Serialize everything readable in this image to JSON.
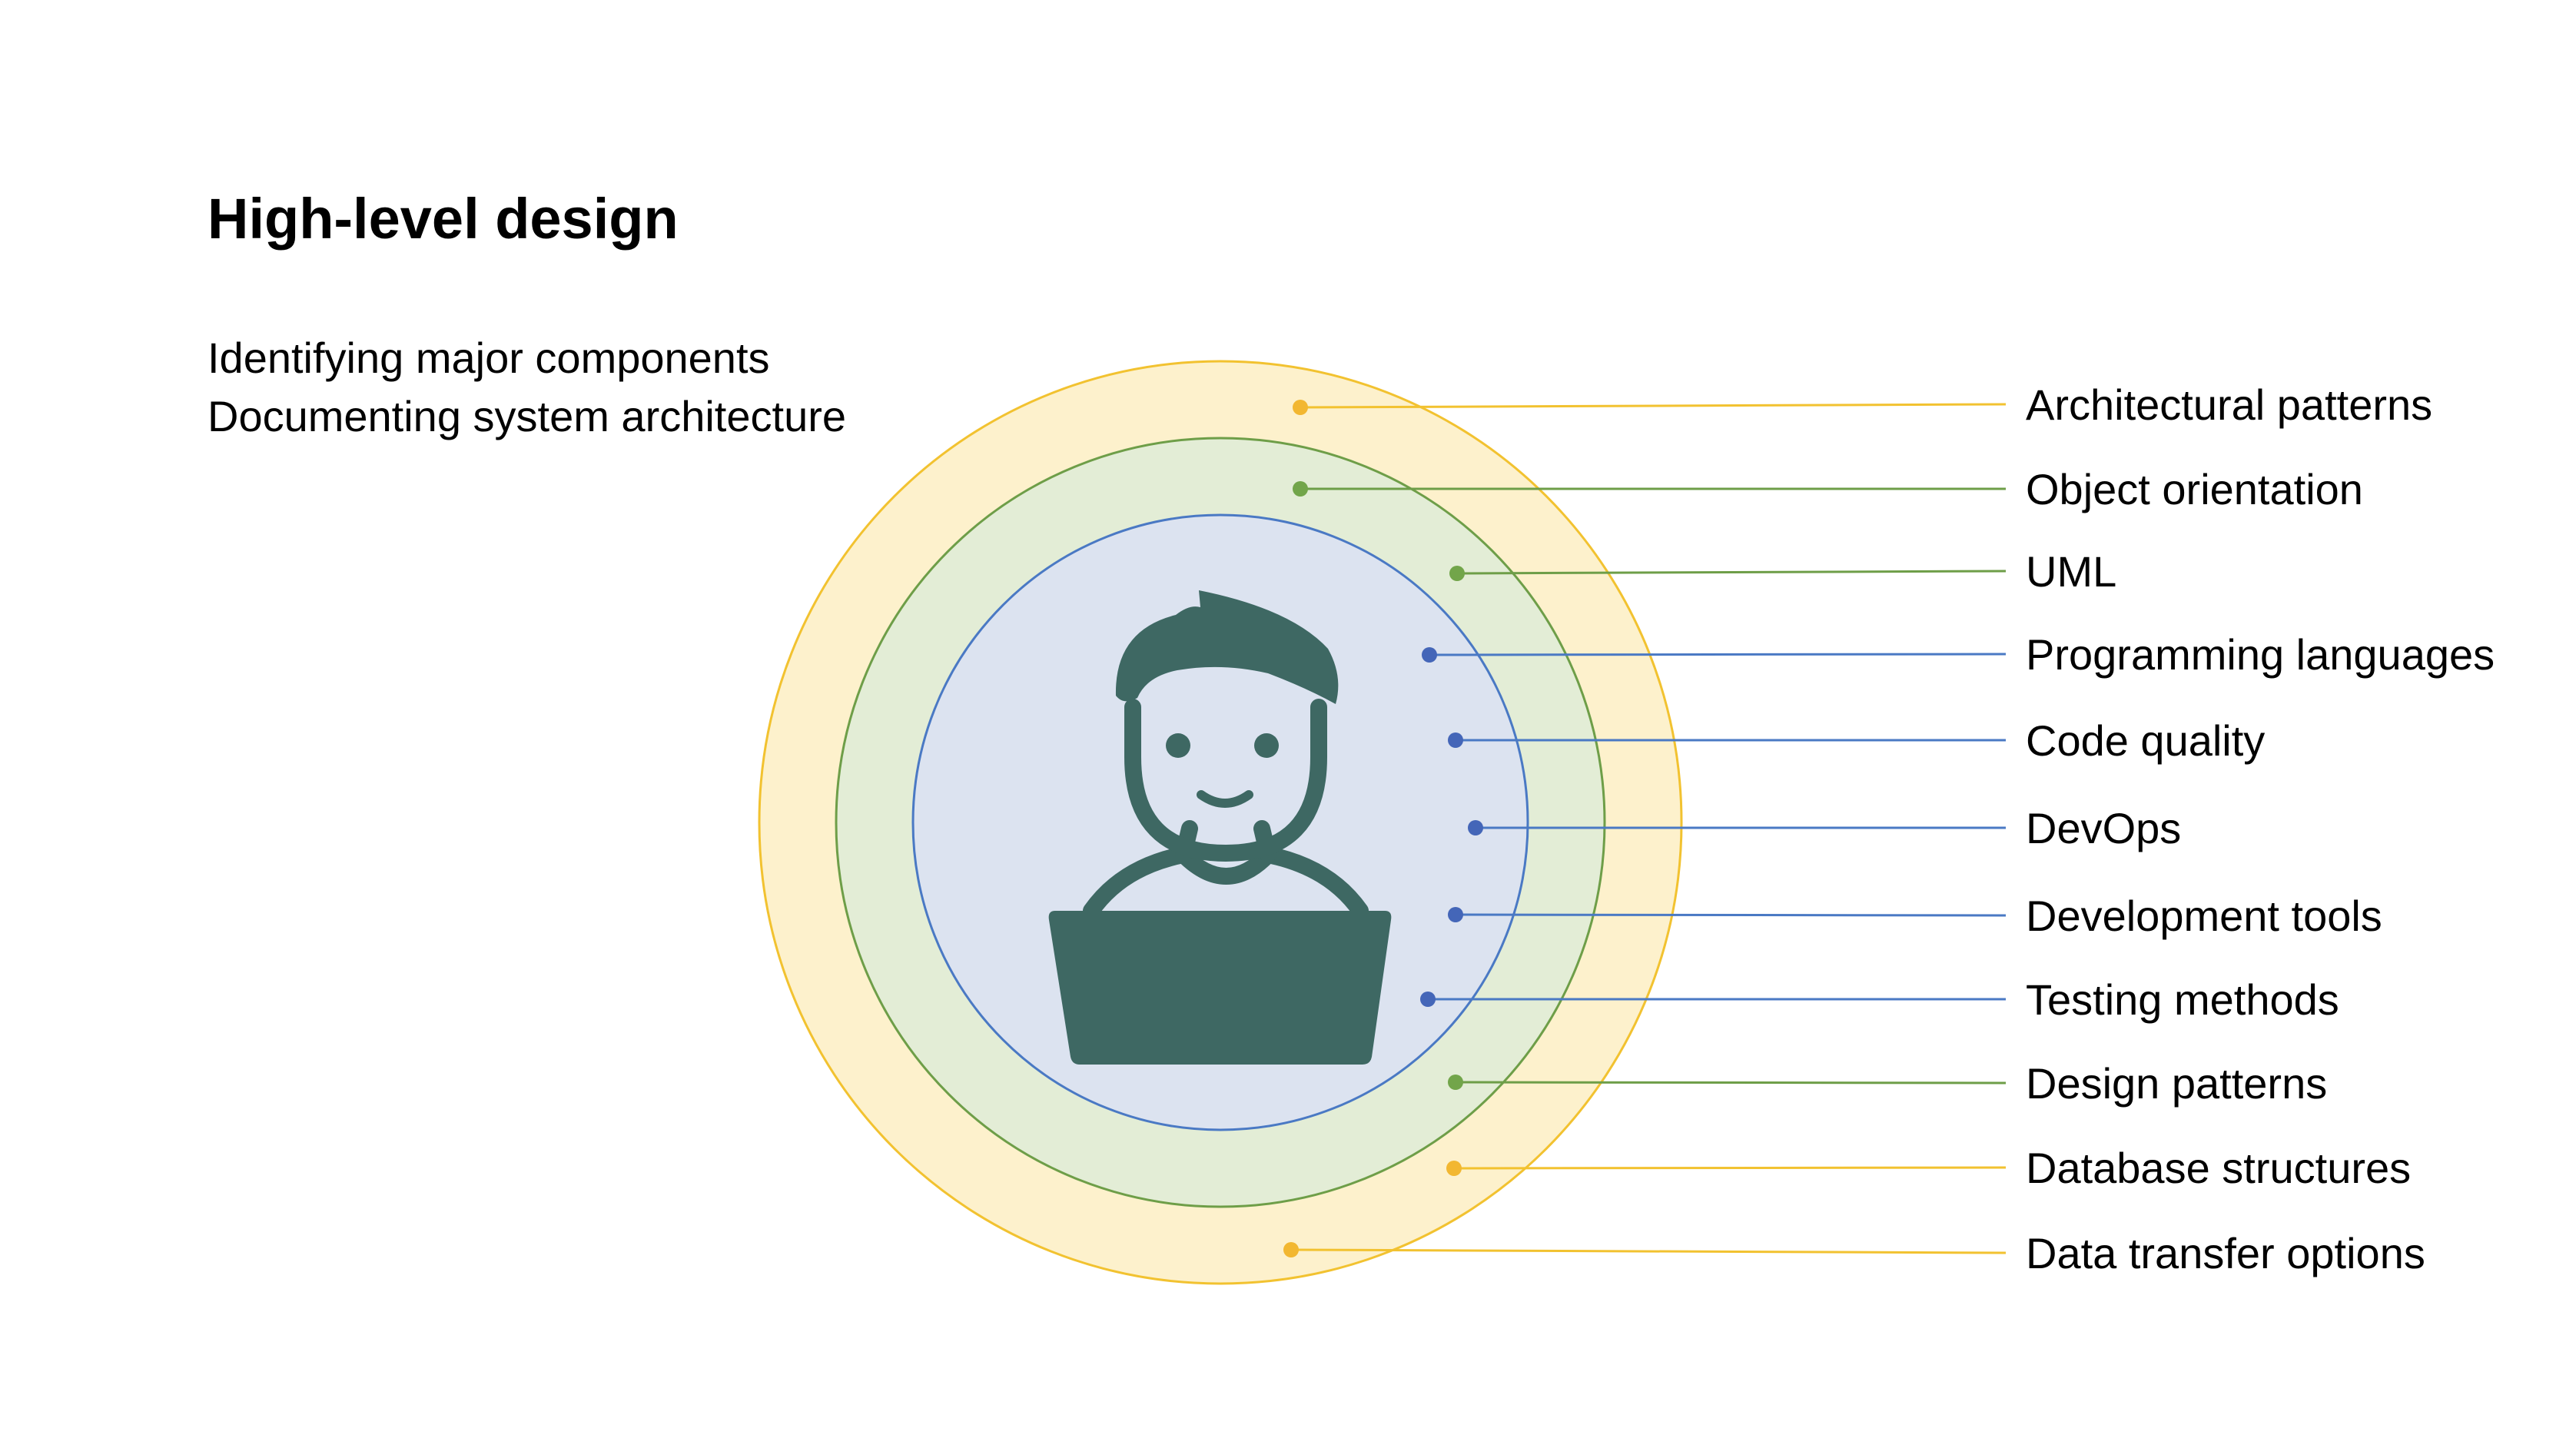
{
  "title": "High-level design",
  "subtitle_lines": [
    "Identifying major components",
    "Documenting system architecture"
  ],
  "colors": {
    "outer_ring_fill": "#FDF1CC",
    "outer_ring_stroke": "#F2C230",
    "middle_ring_fill": "#E3EDD6",
    "middle_ring_stroke": "#6E9E48",
    "inner_circle_fill": "#DCE3F0",
    "inner_circle_stroke": "#4A79C4",
    "developer_icon": "#3E6863",
    "yellow_marker": "#F2B731",
    "green_marker": "#72A54A",
    "blue_marker": "#4466B8"
  },
  "icon": "developer-at-laptop-icon",
  "topics": [
    {
      "label": "Architectural patterns",
      "ring": "outer"
    },
    {
      "label": "Object orientation",
      "ring": "middle"
    },
    {
      "label": "UML",
      "ring": "middle"
    },
    {
      "label": "Programming languages",
      "ring": "inner"
    },
    {
      "label": "Code quality",
      "ring": "inner"
    },
    {
      "label": "DevOps",
      "ring": "inner"
    },
    {
      "label": "Development tools",
      "ring": "inner"
    },
    {
      "label": "Testing methods",
      "ring": "inner"
    },
    {
      "label": "Design patterns",
      "ring": "middle"
    },
    {
      "label": "Database structures",
      "ring": "outer"
    },
    {
      "label": "Data transfer options",
      "ring": "outer"
    }
  ]
}
